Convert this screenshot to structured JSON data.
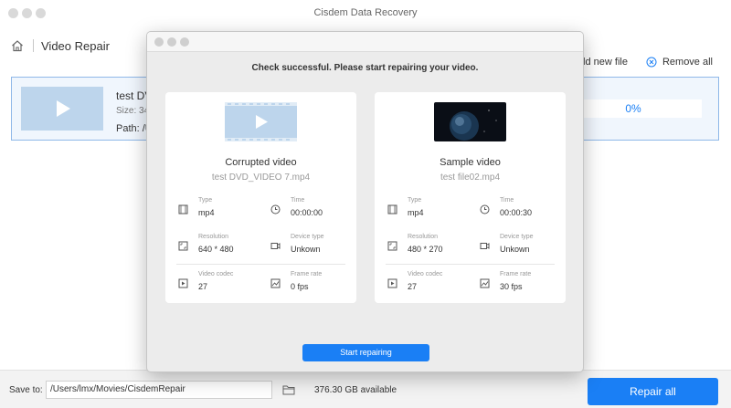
{
  "window": {
    "title": "Cisdem Data Recovery"
  },
  "nav": {
    "title": "Video Repair"
  },
  "toolbar": {
    "add_label": "Add new file",
    "remove_label": "Remove all"
  },
  "file_card": {
    "name": "test DV",
    "size": "Size: 34",
    "path": "Path: /U",
    "progress": "0%"
  },
  "bottom": {
    "save_label": "Save to:",
    "path": "/Users/lmx/Movies/CisdemRepair",
    "available": "376.30 GB available",
    "repair_all": "Repair all"
  },
  "modal": {
    "heading": "Check successful. Please start repairing your video.",
    "start_button": "Start repairing",
    "cards": [
      {
        "title": "Corrupted video",
        "filename": "test DVD_VIDEO 7.mp4",
        "type_label": "Type",
        "type": "mp4",
        "time_label": "Time",
        "time": "00:00:00",
        "resolution_label": "Resolution",
        "resolution": "640 * 480",
        "device_label": "Device type",
        "device": "Unkown",
        "codec_label": "Video codec",
        "codec": "27",
        "framerate_label": "Frame rate",
        "framerate": "0 fps"
      },
      {
        "title": "Sample video",
        "filename": "test file02.mp4",
        "type_label": "Type",
        "type": "mp4",
        "time_label": "Time",
        "time": "00:00:30",
        "resolution_label": "Resolution",
        "resolution": "480 * 270",
        "device_label": "Device type",
        "device": "Unkown",
        "codec_label": "Video codec",
        "codec": "27",
        "framerate_label": "Frame rate",
        "framerate": "30 fps"
      }
    ]
  },
  "colors": {
    "accent": "#1a7ff5",
    "thumb": "#bdd5ec",
    "card_border": "#8fb8e8"
  }
}
